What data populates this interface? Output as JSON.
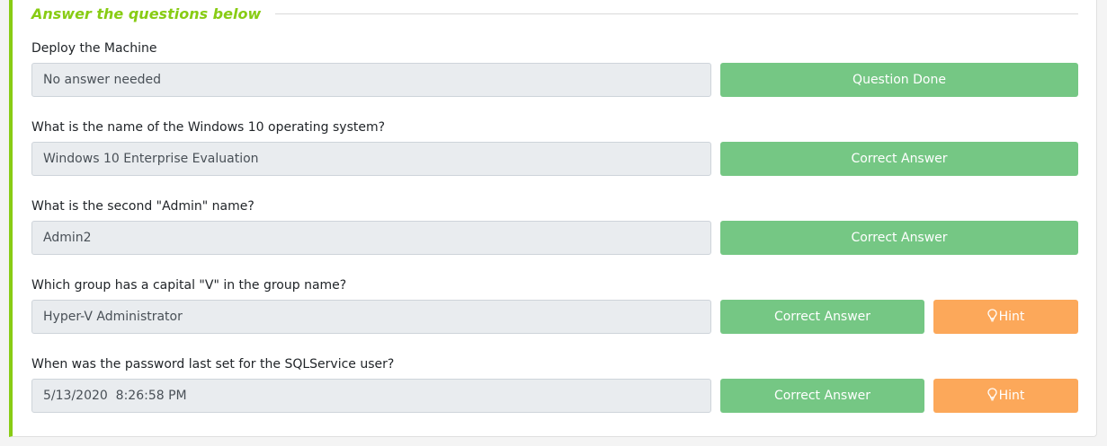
{
  "header": {
    "title": "Answer the questions below"
  },
  "questions": [
    {
      "text": "Deploy the Machine",
      "answer": "No answer needed",
      "button": "Question Done",
      "hint": null
    },
    {
      "text": "What is the name of the Windows 10 operating system?",
      "answer": "Windows 10 Enterprise Evaluation",
      "button": "Correct Answer",
      "hint": null
    },
    {
      "text": "What is the second \"Admin\" name?",
      "answer": "Admin2",
      "button": "Correct Answer",
      "hint": null
    },
    {
      "text": "Which group has a capital \"V\" in the group name?",
      "answer": "Hyper-V Administrator",
      "button": "Correct Answer",
      "hint": "Hint"
    },
    {
      "text": "When was the password last set for the SQLService user?",
      "answer": "5/13/2020  8:26:58 PM",
      "button": "Correct Answer",
      "hint": "Hint"
    }
  ],
  "colors": {
    "accent": "#88cc14",
    "button_green": "#75c784",
    "button_orange": "#fca85a",
    "input_bg": "#e9ecef"
  },
  "icons": {
    "hint_icon": "lightbulb-icon"
  }
}
